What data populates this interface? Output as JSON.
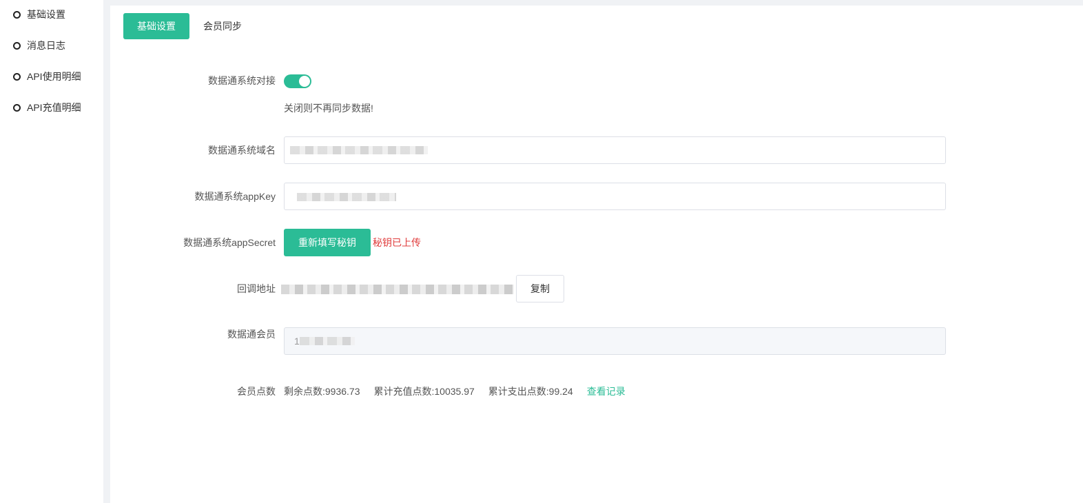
{
  "sidebar": {
    "items": [
      {
        "label": "基础设置"
      },
      {
        "label": "消息日志"
      },
      {
        "label": "API使用明细"
      },
      {
        "label": "API充值明细"
      }
    ]
  },
  "tabs": [
    {
      "label": "基础设置",
      "active": true
    },
    {
      "label": "会员同步",
      "active": false
    }
  ],
  "form": {
    "sync_toggle": {
      "label": "数据通系统对接",
      "enabled": true,
      "hint": "关闭则不再同步数据!"
    },
    "domain": {
      "label": "数据通系统域名"
    },
    "app_key": {
      "label": "数据通系统appKey"
    },
    "app_secret": {
      "label": "数据通系统appSecret",
      "button_label": "重新填写秘钥",
      "status": "秘钥已上传"
    },
    "callback": {
      "label": "回调地址",
      "copy_label": "复制"
    },
    "member": {
      "label": "数据通会员",
      "value_prefix": "1"
    },
    "points": {
      "label": "会员点数",
      "remaining": "剩余点数:9936.73",
      "recharged": "累计充值点数:10035.97",
      "spent": "累计支出点数:99.24",
      "view_link": "查看记录"
    }
  },
  "colors": {
    "accent": "#2bbc96",
    "error": "#e03c3c"
  }
}
